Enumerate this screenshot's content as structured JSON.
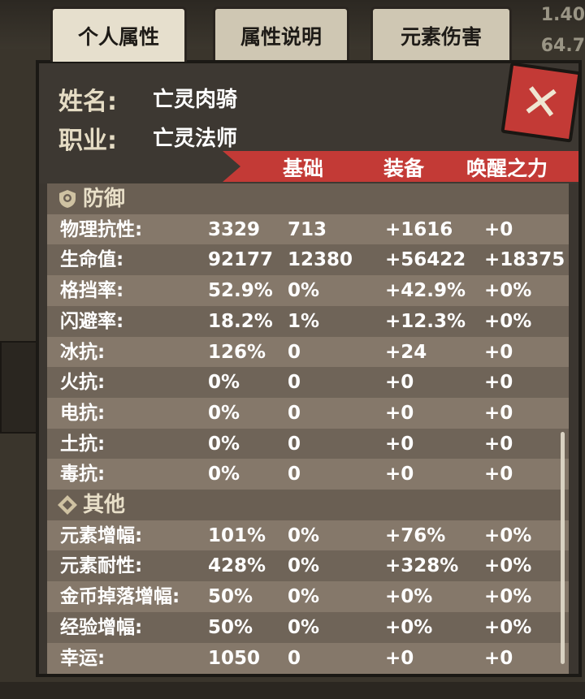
{
  "background": {
    "right_numbers": [
      "1.40",
      "64.7"
    ]
  },
  "tabs": [
    "个人属性",
    "属性说明",
    "元素伤害"
  ],
  "header": {
    "name_label": "姓名:",
    "name_value": "亡灵肉骑",
    "job_label": "职业:",
    "job_value": "亡灵法师"
  },
  "columns": [
    "基础",
    "装备",
    "唤醒之力"
  ],
  "sections": [
    {
      "title": "防御",
      "icon": "shield-icon",
      "rows": [
        {
          "label": "物理抗性:",
          "total": "3329",
          "base": "713",
          "equip": "+1616",
          "awaken": "+0"
        },
        {
          "label": "生命值:",
          "total": "92177",
          "base": "12380",
          "equip": "+56422",
          "awaken": "+18375"
        },
        {
          "label": "格挡率:",
          "total": "52.9%",
          "base": "0%",
          "equip": "+42.9%",
          "awaken": "+0%"
        },
        {
          "label": "闪避率:",
          "total": "18.2%",
          "base": "1%",
          "equip": "+12.3%",
          "awaken": "+0%"
        },
        {
          "label": "冰抗:",
          "total": "126%",
          "base": "0",
          "equip": "+24",
          "awaken": "+0"
        },
        {
          "label": "火抗:",
          "total": "0%",
          "base": "0",
          "equip": "+0",
          "awaken": "+0"
        },
        {
          "label": "电抗:",
          "total": "0%",
          "base": "0",
          "equip": "+0",
          "awaken": "+0"
        },
        {
          "label": "土抗:",
          "total": "0%",
          "base": "0",
          "equip": "+0",
          "awaken": "+0"
        },
        {
          "label": "毒抗:",
          "total": "0%",
          "base": "0",
          "equip": "+0",
          "awaken": "+0"
        }
      ]
    },
    {
      "title": "其他",
      "icon": "diamond-icon",
      "rows": [
        {
          "label": "元素增幅:",
          "total": "101%",
          "base": "0%",
          "equip": "+76%",
          "awaken": "+0%"
        },
        {
          "label": "元素耐性:",
          "total": "428%",
          "base": "0%",
          "equip": "+328%",
          "awaken": "+0%"
        },
        {
          "label": "金币掉落增幅:",
          "total": "50%",
          "base": "0%",
          "equip": "+0%",
          "awaken": "+0%"
        },
        {
          "label": "经验增幅:",
          "total": "50%",
          "base": "0%",
          "equip": "+0%",
          "awaken": "+0%"
        },
        {
          "label": "幸运:",
          "total": "1050",
          "base": "0",
          "equip": "+0",
          "awaken": "+0"
        }
      ]
    }
  ],
  "close_icon": "close-icon",
  "colors": {
    "accent_red": "#c33a36",
    "tab_bg": "#e6dfcd",
    "row_light": "#85786a",
    "row_dark": "#6f6458"
  }
}
